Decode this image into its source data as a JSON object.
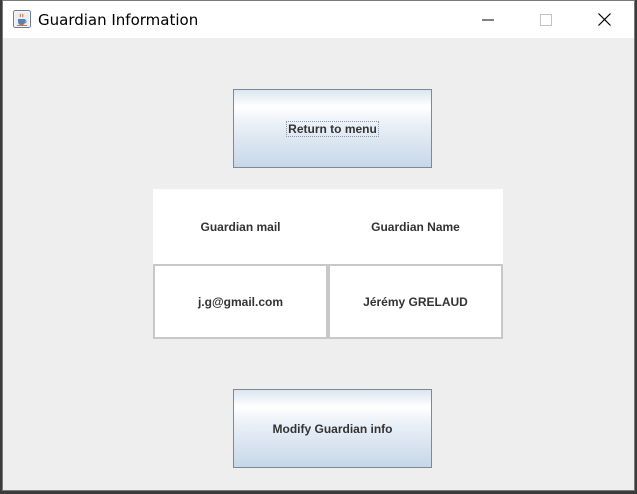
{
  "window": {
    "title": "Guardian Information",
    "icon": "java-cup-icon",
    "controls": [
      "minimize-icon",
      "maximize-icon",
      "close-icon"
    ]
  },
  "buttons": {
    "return_label": "Return to menu",
    "modify_label": "Modify Guardian info"
  },
  "table": {
    "headers": [
      "Guardian mail",
      "Guardian Name"
    ],
    "rows": [
      [
        "j.g@gmail.com",
        "Jérémy GRELAUD"
      ]
    ]
  },
  "colors": {
    "button_gradient_top": "#ffffff",
    "button_gradient_bottom": "#c7d7e8",
    "background": "#eeeeee"
  }
}
